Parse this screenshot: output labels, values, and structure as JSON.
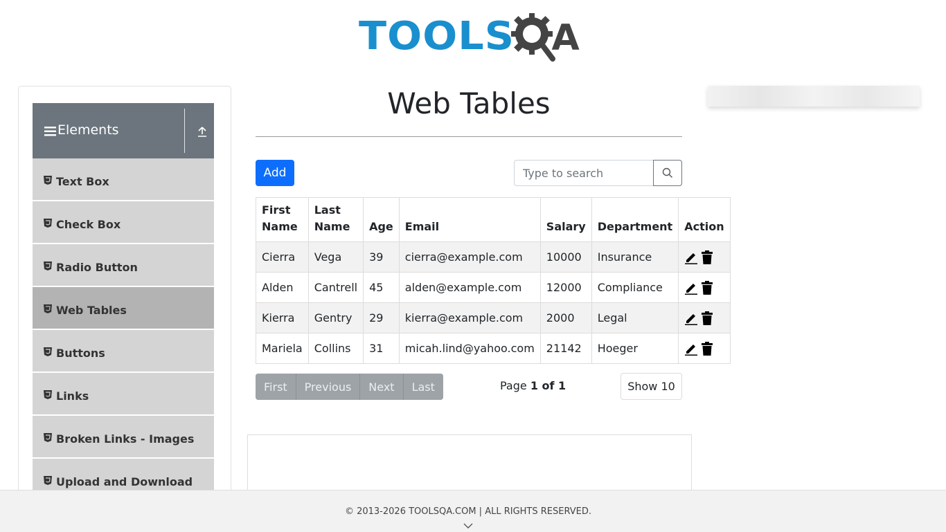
{
  "header": {
    "logo_text": "TOOLS",
    "logo_suffix": "A"
  },
  "sidebar": {
    "group_title": "Elements",
    "items": [
      {
        "label": "Text Box",
        "active": false
      },
      {
        "label": "Check Box",
        "active": false
      },
      {
        "label": "Radio Button",
        "active": false
      },
      {
        "label": "Web Tables",
        "active": true
      },
      {
        "label": "Buttons",
        "active": false
      },
      {
        "label": "Links",
        "active": false
      },
      {
        "label": "Broken Links - Images",
        "active": false
      },
      {
        "label": "Upload and Download",
        "active": false
      }
    ]
  },
  "main": {
    "title": "Web Tables",
    "add_label": "Add",
    "search_placeholder": "Type to search",
    "table": {
      "headers": [
        "First Name",
        "Last Name",
        "Age",
        "Email",
        "Salary",
        "Department",
        "Action"
      ],
      "rows": [
        [
          "Cierra",
          "Vega",
          "39",
          "cierra@example.com",
          "10000",
          "Insurance"
        ],
        [
          "Alden",
          "Cantrell",
          "45",
          "alden@example.com",
          "12000",
          "Compliance"
        ],
        [
          "Kierra",
          "Gentry",
          "29",
          "kierra@example.com",
          "2000",
          "Legal"
        ],
        [
          "Mariela",
          "Collins",
          "31",
          "micah.lind@yahoo.com",
          "21142",
          "Hoeger"
        ]
      ]
    },
    "pagination": {
      "first": "First",
      "previous": "Previous",
      "next": "Next",
      "last": "Last",
      "page_prefix": "Page",
      "page_value": "1 of 1",
      "rows_label": "Show 10"
    }
  },
  "footer": {
    "copyright": "© 2013-2026 TOOLSQA.COM | ALL RIGHTS RESERVED."
  },
  "colors": {
    "primary": "#0d6efd",
    "sidebar_header": "#6c757d",
    "logo_blue": "#1a8fce"
  }
}
